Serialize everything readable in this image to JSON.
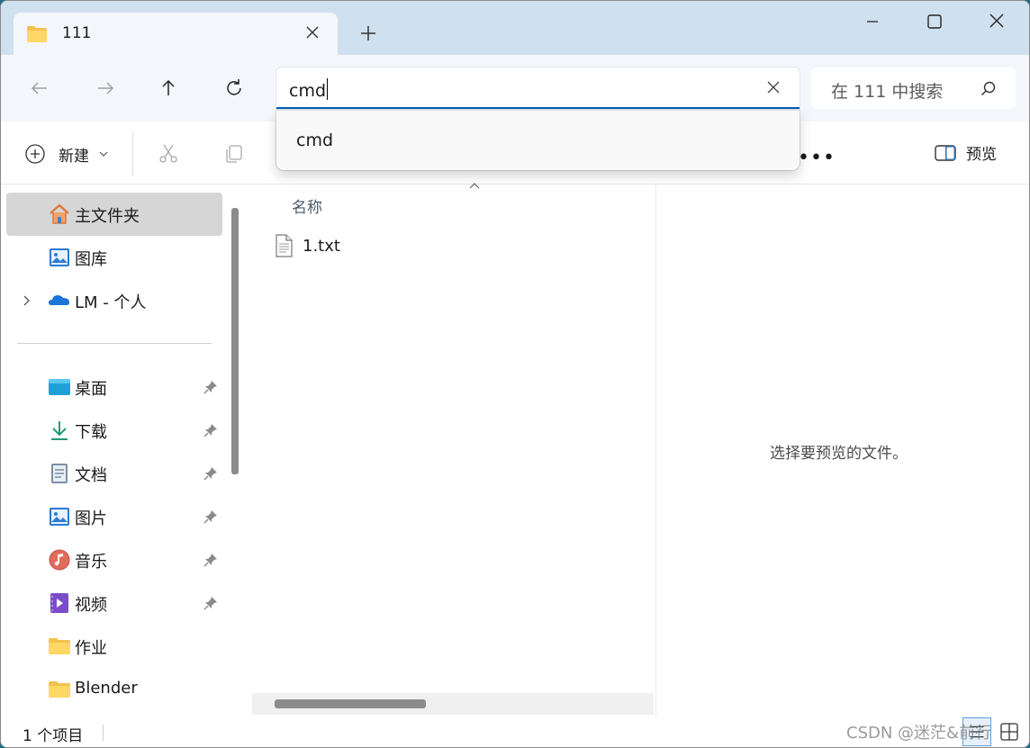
{
  "tab": {
    "title": "111",
    "icon": "folder-icon"
  },
  "window_controls": {
    "minimize_icon": "minimize-icon",
    "maximize_icon": "maximize-icon",
    "close_icon": "close-icon"
  },
  "navigation": {
    "address_value": "cmd",
    "search_placeholder": "在 111 中搜索"
  },
  "autocomplete": {
    "items": [
      "cmd"
    ]
  },
  "toolbar": {
    "new_label": "新建",
    "more_label": "•••",
    "preview_label": "预览"
  },
  "sidebar": {
    "items": [
      {
        "label": "主文件夹",
        "icon": "home-icon",
        "active": true
      },
      {
        "label": "图库",
        "icon": "gallery-icon"
      },
      {
        "label": "LM - 个人",
        "icon": "onedrive-icon",
        "expandable": true
      },
      {
        "label": "桌面",
        "icon": "desktop-icon",
        "pinned": true
      },
      {
        "label": "下载",
        "icon": "download-icon",
        "pinned": true
      },
      {
        "label": "文档",
        "icon": "documents-icon",
        "pinned": true
      },
      {
        "label": "图片",
        "icon": "pictures-icon",
        "pinned": true
      },
      {
        "label": "音乐",
        "icon": "music-icon",
        "pinned": true
      },
      {
        "label": "视频",
        "icon": "videos-icon",
        "pinned": true
      },
      {
        "label": "作业",
        "icon": "folder-icon"
      },
      {
        "label": "Blender",
        "icon": "folder-icon"
      }
    ]
  },
  "main": {
    "column_header": "名称",
    "files": [
      {
        "name": "1.txt",
        "icon": "text-file-icon"
      }
    ]
  },
  "preview_pane": {
    "message": "选择要预览的文件。"
  },
  "statusbar": {
    "item_count": "1 个项目"
  },
  "watermark": "CSDN @迷茫&前行",
  "colors": {
    "accent": "#005fb8",
    "titlebar": "#cfe0ef",
    "navbar": "#f3f6fa"
  }
}
